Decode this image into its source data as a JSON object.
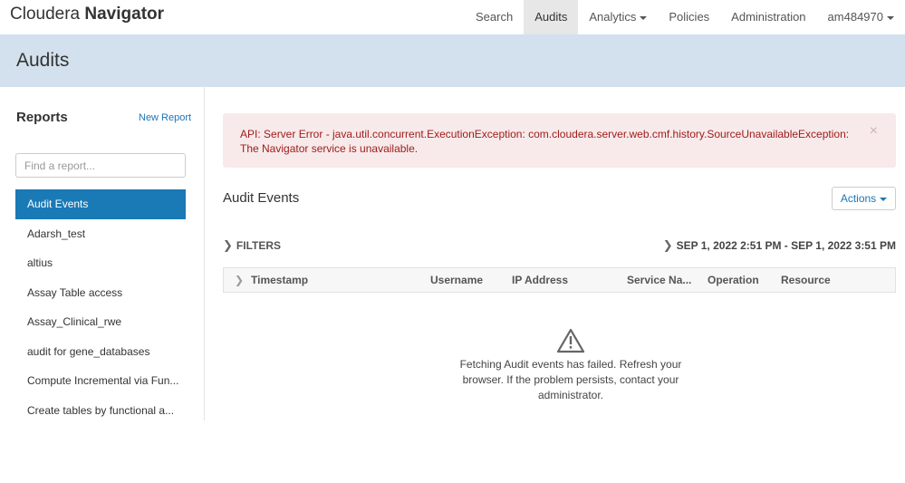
{
  "brand": {
    "part1": "Cloudera",
    "part2": "Navigator"
  },
  "nav": [
    {
      "label": "Search"
    },
    {
      "label": "Audits"
    },
    {
      "label": "Analytics"
    },
    {
      "label": "Policies"
    },
    {
      "label": "Administration"
    },
    {
      "label": "am484970"
    }
  ],
  "page": {
    "title": "Audits"
  },
  "sidebar": {
    "title": "Reports",
    "new_report": "New Report",
    "search_placeholder": "Find a report...",
    "items": [
      {
        "label": "Audit Events"
      },
      {
        "label": "Adarsh_test"
      },
      {
        "label": "altius"
      },
      {
        "label": "Assay Table access"
      },
      {
        "label": "Assay_Clinical_rwe"
      },
      {
        "label": "audit for gene_databases"
      },
      {
        "label": "Compute Incremental via Fun..."
      },
      {
        "label": "Create tables by functional a..."
      }
    ]
  },
  "alert": {
    "message": "API: Server Error - java.util.concurrent.ExecutionException: com.cloudera.server.web.cmf.history.SourceUnavailableException: The Navigator service is unavailable.",
    "close": "×"
  },
  "main": {
    "title": "Audit Events",
    "actions_label": "Actions",
    "filters_label": "FILTERS",
    "date_range": "SEP 1, 2022 2:51 PM - SEP 1, 2022 3:51 PM",
    "columns": [
      "Timestamp",
      "Username",
      "IP Address",
      "Service Na...",
      "Operation",
      "Resource"
    ],
    "empty_message": "Fetching Audit events has failed. Refresh your browser. If the problem persists, contact your administrator."
  },
  "colors": {
    "accent": "#1a7ab5",
    "header_band": "#d3e1ee",
    "alert_bg": "#f8eaea",
    "alert_text": "#a01c1c"
  },
  "icons": {
    "warning": "warning-triangle-icon",
    "expand": "chevron-right-icon",
    "dropdown": "caret-down-icon"
  }
}
